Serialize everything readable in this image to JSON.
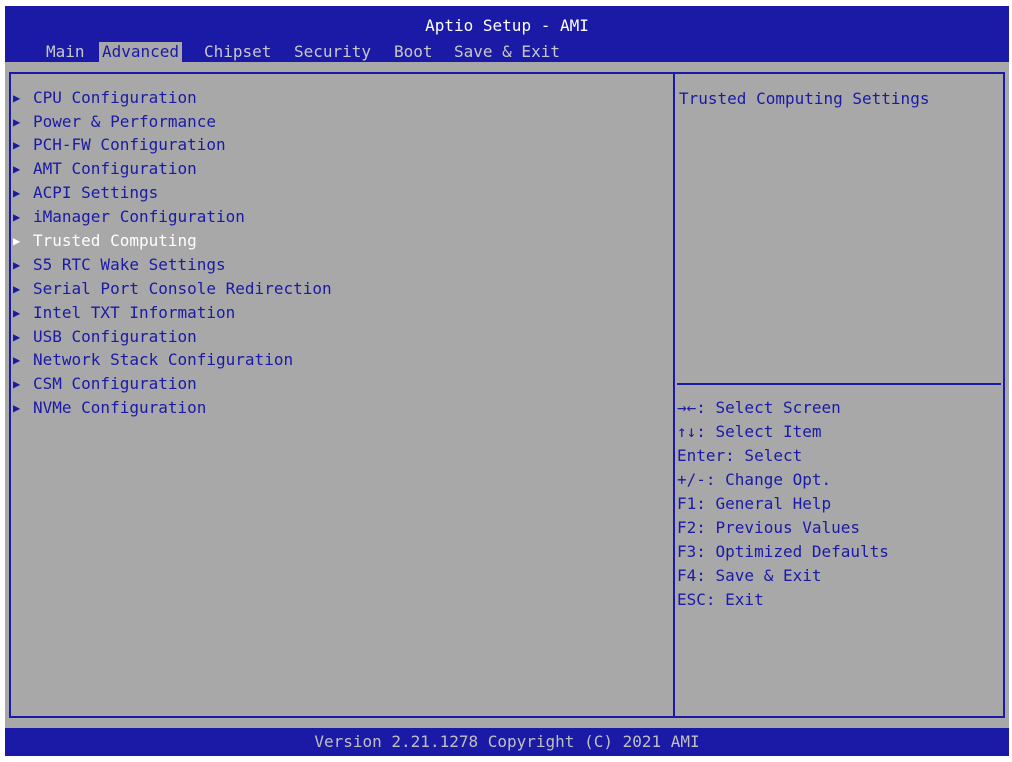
{
  "header": {
    "title": "Aptio Setup - AMI",
    "tabs": [
      {
        "label": "Main"
      },
      {
        "label": "Advanced"
      },
      {
        "label": "Chipset"
      },
      {
        "label": "Security"
      },
      {
        "label": "Boot"
      },
      {
        "label": "Save & Exit"
      }
    ],
    "active_tab": "Advanced"
  },
  "menu": {
    "items": [
      {
        "label": "CPU Configuration"
      },
      {
        "label": "Power & Performance"
      },
      {
        "label": "PCH-FW Configuration"
      },
      {
        "label": "AMT Configuration"
      },
      {
        "label": "ACPI Settings"
      },
      {
        "label": "iManager Configuration"
      },
      {
        "label": "Trusted Computing"
      },
      {
        "label": "S5 RTC Wake Settings"
      },
      {
        "label": "Serial Port Console Redirection"
      },
      {
        "label": "Intel TXT Information"
      },
      {
        "label": "USB Configuration"
      },
      {
        "label": "Network Stack Configuration"
      },
      {
        "label": "CSM Configuration"
      },
      {
        "label": "NVMe Configuration"
      }
    ],
    "selected_item": "Trusted Computing",
    "submenu_arrow": "▶"
  },
  "help": {
    "description": "Trusted Computing Settings",
    "keys": [
      "→←: Select Screen",
      "↑↓: Select Item",
      "Enter: Select",
      "+/-: Change Opt.",
      "F1: General Help",
      "F2: Previous Values",
      "F3: Optimized Defaults",
      "F4: Save & Exit",
      "ESC: Exit"
    ]
  },
  "footer": {
    "version": "Version 2.21.1278 Copyright (C) 2021 AMI"
  },
  "colors": {
    "frame_blue": "#1a1aa6",
    "background_gray": "#a8a8a8",
    "selected_text": "#ffffff"
  }
}
